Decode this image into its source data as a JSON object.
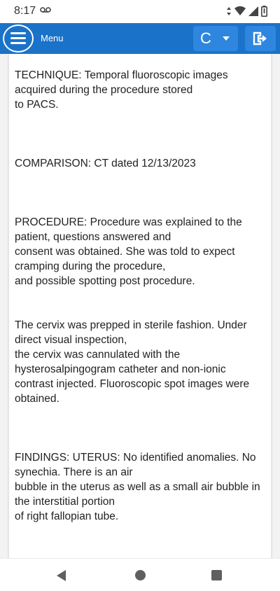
{
  "status_bar": {
    "time": "8:17",
    "icons": [
      "voicemail-icon",
      "data-arrows-icon",
      "wifi-icon",
      "signal-icon",
      "battery-icon"
    ]
  },
  "app_bar": {
    "menu_label": "Menu",
    "selector_value": "C",
    "colors": {
      "bar": "#1a73c9",
      "button": "#2f86de"
    }
  },
  "report": {
    "technique": "TECHNIQUE: Temporal fluoroscopic images\nacquired during the procedure stored\nto PACS.",
    "comparison": "COMPARISON: CT dated 12/13/2023",
    "procedure": "PROCEDURE: Procedure was explained to the\npatient, questions answered and\nconsent was obtained. She was told to expect\ncramping during the procedure,\nand possible spotting post procedure.",
    "cervix": "The cervix was prepped in sterile fashion. Under\ndirect visual inspection,\nthe cervix was cannulated with the\nhysterosalpingogram catheter and non-ionic\ncontrast injected. Fluoroscopic spot images were\nobtained.",
    "findings": "FINDINGS: UTERUS: No identified anomalies. No\nsynechia. There is an air\nbubble in the uterus as well as a small air bubble in\nthe interstitial portion\nof right fallopian tube."
  },
  "nav_bar": {
    "buttons": [
      "back-icon",
      "home-icon",
      "recents-icon"
    ]
  }
}
